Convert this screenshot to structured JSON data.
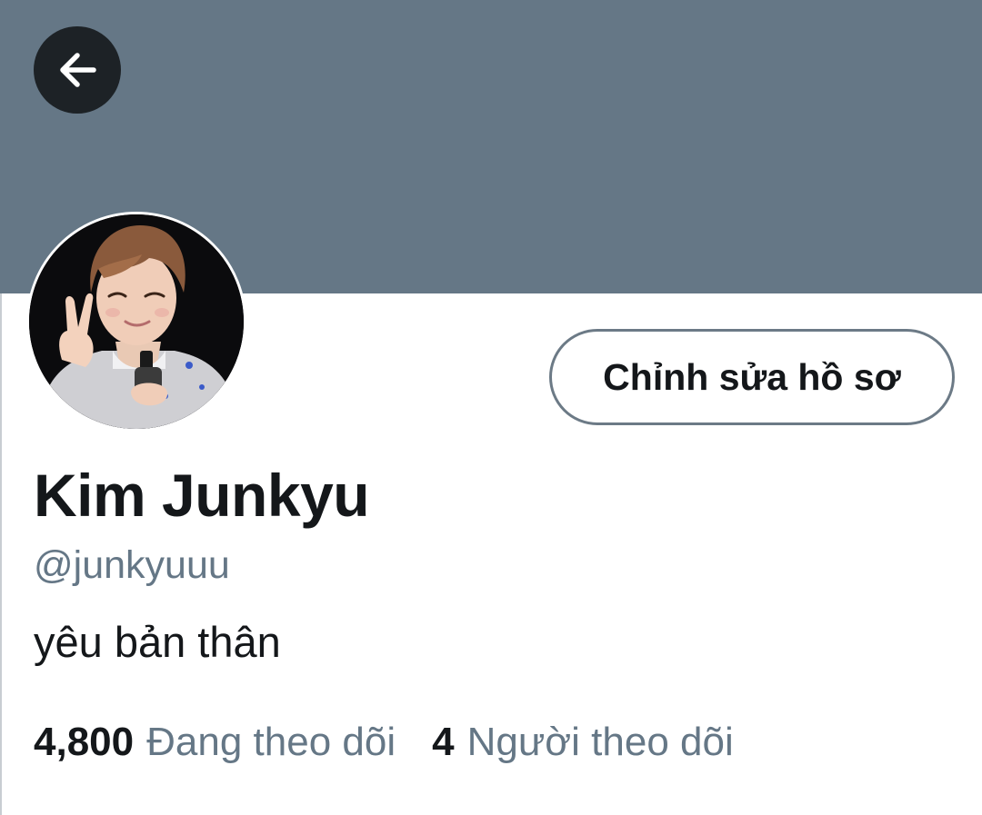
{
  "colors": {
    "banner": "#657786",
    "back_button_bg": "#1d2226",
    "text_primary": "#14171a",
    "text_secondary": "#657786",
    "button_border": "#6c7a86"
  },
  "icons": {
    "back": "arrow-left-icon"
  },
  "profile": {
    "display_name": "Kim Junkyu",
    "handle": "@junkyuuu",
    "bio": "yêu bản thân",
    "edit_button_label": "Chỉnh sửa hồ sơ"
  },
  "stats": {
    "following_count": "4,800",
    "following_label": "Đang theo dõi",
    "followers_count": "4",
    "followers_label": "Người theo dõi"
  }
}
